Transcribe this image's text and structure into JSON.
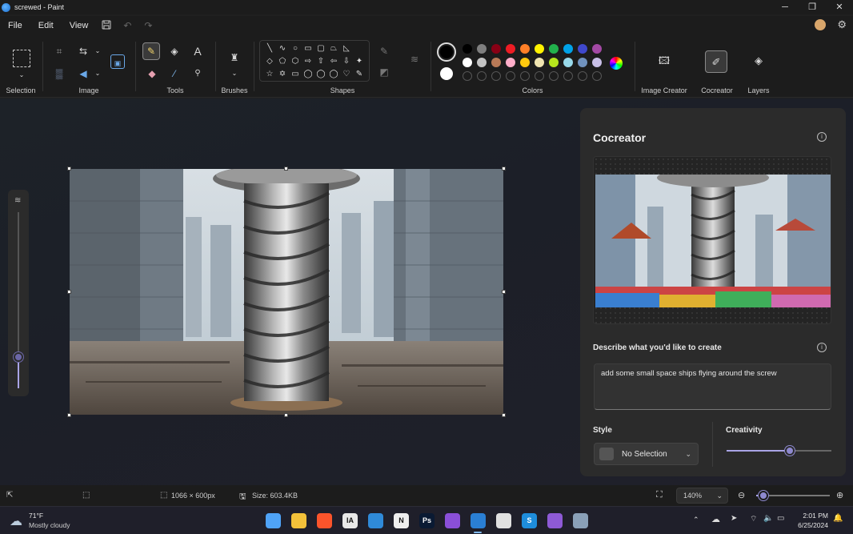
{
  "window": {
    "title": "screwed - Paint",
    "minimize": "─",
    "maximize": "❐",
    "close": "✕"
  },
  "menu": {
    "file": "File",
    "edit": "Edit",
    "view": "View",
    "save_icon": "save-icon",
    "undo_icon": "undo-icon",
    "redo_icon": "redo-icon",
    "avatar": "●"
  },
  "ribbon": {
    "groups": {
      "selection": "Selection",
      "image": "Image",
      "tools": "Tools",
      "brushes": "Brushes",
      "shapes": "Shapes",
      "colors": "Colors",
      "image_creator": "Image Creator",
      "cocreator": "Cocreator",
      "layers": "Layers"
    },
    "shapes": [
      "╲",
      "∿",
      "○",
      "▭",
      "▢",
      "⏢",
      "◺",
      "",
      "◇",
      "⬠",
      "⬡",
      "⇨",
      "⇧",
      "⇦",
      "⇩",
      "✦",
      "☆",
      "✡",
      "▭",
      "◯",
      "◯",
      "◯",
      "♡",
      "✎"
    ],
    "colors_row1": [
      "#000000",
      "#7f7f7f",
      "#880015",
      "#ed1c24",
      "#ff7f27",
      "#fff200",
      "#22b14c",
      "#00a2e8",
      "#3f48cc",
      "#a349a4"
    ],
    "colors_row2": [
      "#ffffff",
      "#c3c3c3",
      "#b97a57",
      "#ffaec9",
      "#ffc90e",
      "#efe4b0",
      "#b5e61d",
      "#99d9ea",
      "#7092be",
      "#c8bfe7"
    ],
    "primary_color": "#000000",
    "secondary_color": "#ffffff"
  },
  "cocreator": {
    "title": "Cocreator",
    "describe_label": "Describe what you'd like to create",
    "prompt": "add some small space ships flying around the screw",
    "style_label": "Style",
    "style_value": "No Selection",
    "creativity_label": "Creativity",
    "creativity_level": 0.6
  },
  "status": {
    "dimensions": "1066 × 600px",
    "size": "Size: 603.4KB",
    "zoom": "140%",
    "zoom_level": 0.1
  },
  "taskbar": {
    "temp": "71°F",
    "weather": "Mostly cloudy",
    "time": "2:01 PM",
    "date": "6/25/2024",
    "apps": [
      {
        "name": "start",
        "label": "",
        "color": "#4fa3f7"
      },
      {
        "name": "explorer",
        "label": "",
        "color": "#f3c13a"
      },
      {
        "name": "brave",
        "label": "",
        "color": "#fb542b"
      },
      {
        "name": "ia",
        "label": "IA",
        "color": "#e8e8e8"
      },
      {
        "name": "vscode",
        "label": "",
        "color": "#2f8ad8"
      },
      {
        "name": "notion",
        "label": "N",
        "color": "#eeeeee"
      },
      {
        "name": "photoshop",
        "label": "Ps",
        "color": "#0a1a33"
      },
      {
        "name": "affinity",
        "label": "",
        "color": "#8a4fd8"
      },
      {
        "name": "paint",
        "label": "",
        "color": "#2a7fd4"
      },
      {
        "name": "slack",
        "label": "",
        "color": "#e0e0e0"
      },
      {
        "name": "skype",
        "label": "S",
        "color": "#1e8ddb"
      },
      {
        "name": "visualstudio",
        "label": "",
        "color": "#8e5ad6"
      },
      {
        "name": "settings",
        "label": "",
        "color": "#8aa0b8"
      }
    ]
  }
}
